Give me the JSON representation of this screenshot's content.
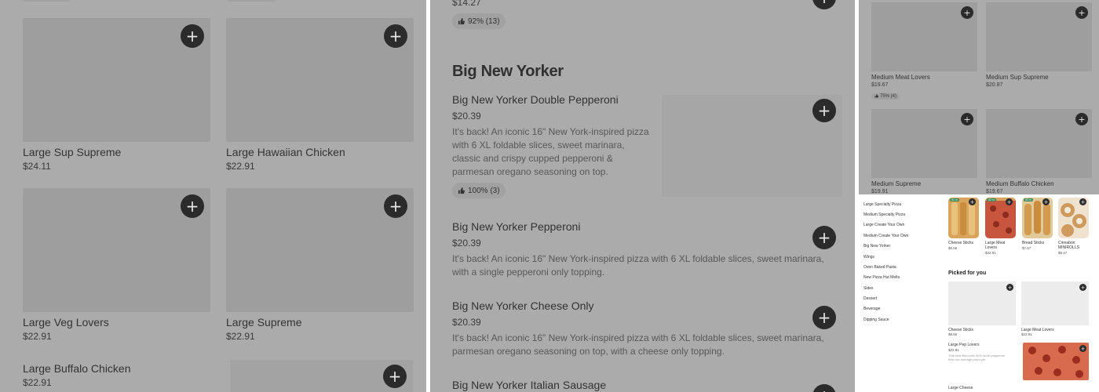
{
  "panel_a": {
    "cards": [
      {
        "name": "Large Sup Supreme",
        "price": "$24.11"
      },
      {
        "name": "Large Hawaiian Chicken",
        "price": "$22.91"
      },
      {
        "name": "Large Veg Lovers",
        "price": "$22.91"
      },
      {
        "name": "Large Supreme",
        "price": "$22.91"
      },
      {
        "name": "Large Buffalo Chicken",
        "price": "$22.91"
      }
    ],
    "add_glyph": "+"
  },
  "panel_b": {
    "top_price": "$14.27",
    "top_rating": "92% (13)",
    "section_title": "Big New Yorker",
    "items": [
      {
        "name": "Big New Yorker Double Pepperoni",
        "price": "$20.39",
        "desc_lines": [
          "It's back! An iconic 16\" New York-inspired pizza",
          "with 6 XL foldable slices, sweet marinara,",
          "classic and crispy cupped pepperoni &",
          "parmesan oregano seasoning on top."
        ],
        "rating": "100% (3)"
      },
      {
        "name": "Big New Yorker Pepperoni",
        "price": "$20.39",
        "desc_lines": [
          "It's back! An iconic 16\" New York-inspired pizza with 6 XL foldable slices, sweet marinara,",
          "with a single pepperoni only topping."
        ]
      },
      {
        "name": "Big New Yorker Cheese Only",
        "price": "$20.39",
        "desc_lines": [
          "It's back! An iconic 16\" New York-inspired pizza with 6 XL foldable slices, sweet marinara,",
          "parmesan oregano seasoning on top, with a cheese only topping."
        ]
      },
      {
        "name": "Big New Yorker Italian Sausage"
      }
    ],
    "add_glyph": "+"
  },
  "panel_c": {
    "cards": [
      {
        "name": "Medium Meat Lovers",
        "price": "$19.67",
        "rating": "75% (4)"
      },
      {
        "name": "Medium Sup Supreme",
        "price": "$20.87"
      },
      {
        "name": "Medium Supreme",
        "price": "$19.91"
      },
      {
        "name": "Medium Buffalo Chicken",
        "price": "$19.67"
      }
    ],
    "add_glyph": "+"
  },
  "panel_d": {
    "categories": [
      "Large Specialty Pizza",
      "Medium Specialty Pizza",
      "Large Create Your Own",
      "Medium Create Your Own",
      "Big New Yorker",
      "Wings",
      "Oven Baked Pasta",
      "New Pizza Hut Melts",
      "Sides",
      "Dessert",
      "Beverage",
      "Dipping Sauce"
    ],
    "top_items": [
      {
        "name": "Cheese Sticks",
        "price": "$8.55",
        "badge": "#1 m"
      },
      {
        "name": "Large Meat Lovers",
        "price": "$22.91",
        "badge": "#2 m"
      },
      {
        "name": "Bread Sticks",
        "price": "$7.67",
        "badge": "#3 m"
      },
      {
        "name": "Cinnabon MINIROLLS",
        "price": "$8.47"
      }
    ],
    "picked_title": "Picked for you",
    "picked": [
      {
        "name": "Cheese Sticks",
        "price": "$8.55"
      },
      {
        "name": "Large Meat Lovers",
        "price": "$22.91"
      }
    ],
    "pep_item": {
      "name": "Large Pep Lovers",
      "price": "$22.91",
      "desc": "This item filled with 50% more pepperoni than our average pizza pie."
    },
    "last_item": {
      "name": "Large Cheese"
    },
    "add_glyph": "+",
    "colors": {
      "pizza_red": "#c8553d",
      "crust": "#d9a45b",
      "badge_green": "#3f8a5a"
    }
  }
}
